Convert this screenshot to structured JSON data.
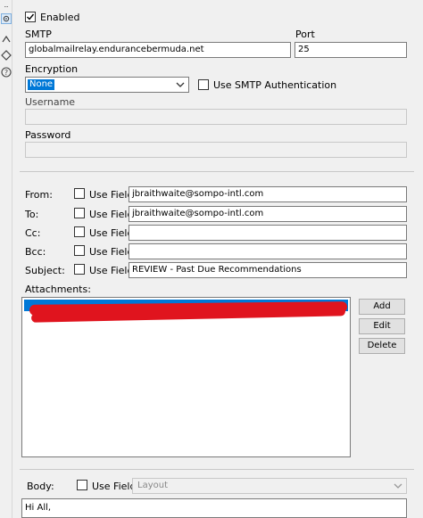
{
  "general": {
    "enabled_label": "Enabled",
    "enabled_checked": true
  },
  "smtp": {
    "label": "SMTP",
    "value": "globalmailrelay.endurancebermuda.net",
    "port_label": "Port",
    "port_value": "25"
  },
  "encryption": {
    "label": "Encryption",
    "selected": "None",
    "smtp_auth_label": "Use SMTP Authentication",
    "smtp_auth_checked": false
  },
  "credentials": {
    "username_label": "Username",
    "username_value": "",
    "password_label": "Password",
    "password_value": ""
  },
  "fields": [
    {
      "label": "From:",
      "use_field_label": "Use Field",
      "value": "jbraithwaite@sompo-intl.com"
    },
    {
      "label": "To:",
      "use_field_label": "Use Field",
      "value": "jbraithwaite@sompo-intl.com"
    },
    {
      "label": "Cc:",
      "use_field_label": "Use Field",
      "value": ""
    },
    {
      "label": "Bcc:",
      "use_field_label": "Use Field",
      "value": ""
    },
    {
      "label": "Subject:",
      "use_field_label": "Use Field",
      "value": "REVIEW - Past Due Recommendations"
    }
  ],
  "attachments": {
    "label": "Attachments:",
    "buttons": {
      "add": "Add",
      "edit": "Edit",
      "delete": "Delete"
    }
  },
  "body": {
    "label": "Body:",
    "use_field_label": "Use Field",
    "layout_placeholder": "Layout",
    "text": "Hi All,"
  },
  "colors": {
    "accent": "#0078d7",
    "redaction": "#e0141e"
  },
  "icons": [
    "gear-icon",
    "connection-icon",
    "tag-icon",
    "help-icon",
    "check-icon",
    "chevron-down-icon"
  ]
}
